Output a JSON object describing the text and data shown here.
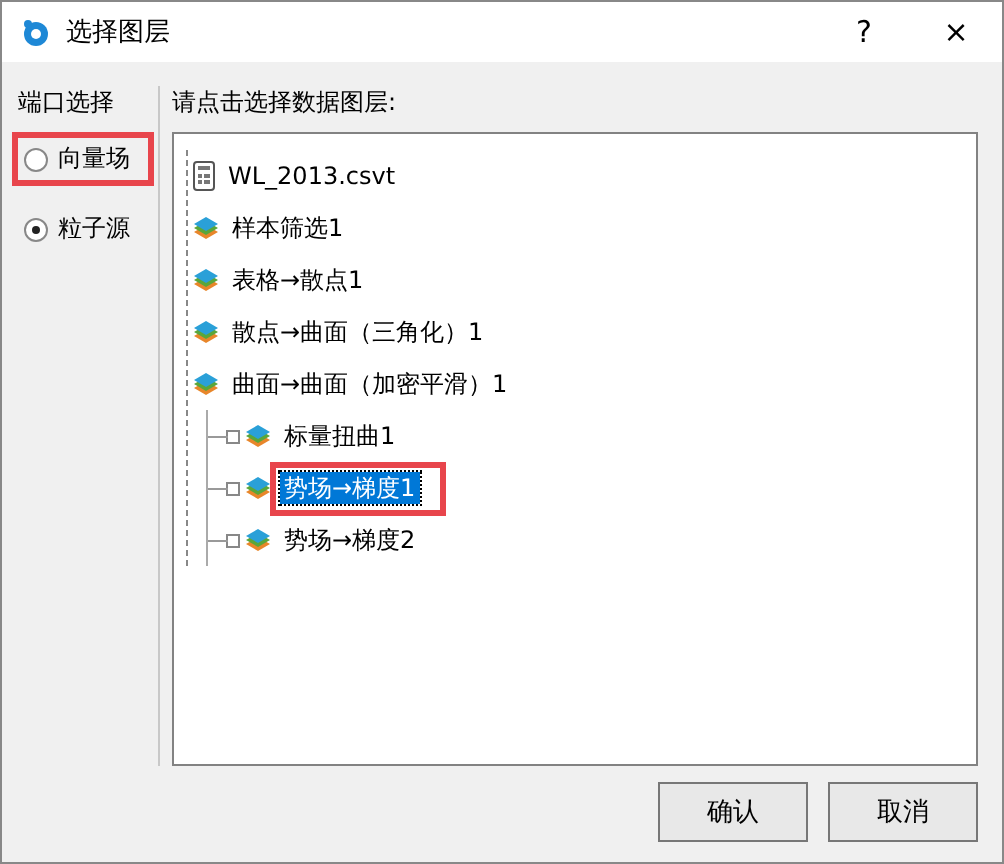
{
  "window": {
    "title": "选择图层",
    "buttons": [
      "?",
      "×"
    ]
  },
  "port_panel": {
    "label": "端口选择",
    "options": [
      {
        "label": "向量场",
        "selected": false,
        "highlighted": true
      },
      {
        "label": "粒子源",
        "selected": true,
        "highlighted": false
      }
    ]
  },
  "layer_panel": {
    "label": "请点击选择数据图层:",
    "tree": [
      {
        "label": "WL_2013.csvt",
        "kind": "file",
        "selected": false,
        "highlighted": false
      },
      {
        "label": "样本筛选1",
        "kind": "layer",
        "selected": false,
        "highlighted": false
      },
      {
        "label": "表格→散点1",
        "kind": "layer",
        "selected": false,
        "highlighted": false
      },
      {
        "label": "散点→曲面（三角化）1",
        "kind": "layer",
        "selected": false,
        "highlighted": false
      },
      {
        "label": "曲面→曲面（加密平滑）1",
        "kind": "layer",
        "selected": false,
        "highlighted": false,
        "children": [
          {
            "label": "标量扭曲1",
            "kind": "layer",
            "selected": false,
            "highlighted": false
          },
          {
            "label": "势场→梯度1",
            "kind": "layer",
            "selected": true,
            "highlighted": true
          },
          {
            "label": "势场→梯度2",
            "kind": "layer",
            "selected": false,
            "highlighted": false
          }
        ]
      }
    ]
  },
  "buttons": [
    "确认",
    "取消"
  ]
}
